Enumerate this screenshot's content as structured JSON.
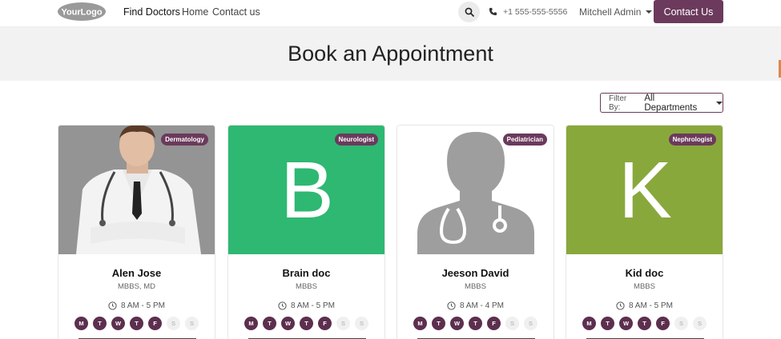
{
  "nav": {
    "logo_text": "YourLogo",
    "links": [
      "Find Doctors",
      "Home",
      "Contact us"
    ],
    "phone": "+1 555-555-5556",
    "user": "Mitchell Admin",
    "contact_button": "Contact Us"
  },
  "page": {
    "title": "Book an Appointment"
  },
  "filter": {
    "label": "Filter By:",
    "value": "All Departments"
  },
  "colors": {
    "brand": "#6b3a5c",
    "brain_bg": "#2eb872",
    "kid_bg": "#89a83c"
  },
  "doctors": [
    {
      "name": "Alen Jose",
      "qualification": "MBBS, MD",
      "department": "Dermatology",
      "hours": "8 AM - 5 PM",
      "image": "photo"
    },
    {
      "name": "Brain doc",
      "qualification": "MBBS",
      "department": "Neurologist",
      "hours": "8 AM - 5 PM",
      "image": "initial",
      "initial": "B"
    },
    {
      "name": "Jeeson David",
      "qualification": "MBBS",
      "department": "Pediatrician",
      "hours": "8 AM - 4 PM",
      "image": "placeholder"
    },
    {
      "name": "Kid doc",
      "qualification": "MBBS",
      "department": "Nephrologist",
      "hours": "8 AM - 5 PM",
      "image": "initial",
      "initial": "K"
    }
  ],
  "days": [
    {
      "label": "M",
      "available": true
    },
    {
      "label": "T",
      "available": true
    },
    {
      "label": "W",
      "available": true
    },
    {
      "label": "T",
      "available": true
    },
    {
      "label": "F",
      "available": true
    },
    {
      "label": "S",
      "available": false
    },
    {
      "label": "S",
      "available": false
    }
  ]
}
